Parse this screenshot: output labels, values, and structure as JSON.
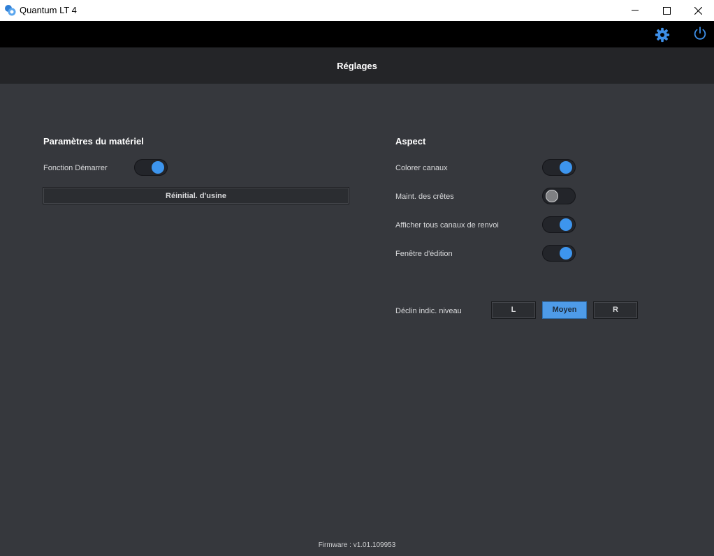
{
  "window": {
    "title": "Quantum LT 4",
    "accent": "#3d95ee"
  },
  "toolbar": {
    "settings_icon": "gear-icon",
    "power_icon": "power-icon"
  },
  "header": {
    "title": "Réglages"
  },
  "hardware": {
    "title": "Paramètres du matériel",
    "start_label": "Fonction Démarrer",
    "start_on": true,
    "factory_reset_label": "Réinitial. d'usine"
  },
  "aspect": {
    "title": "Aspect",
    "items": [
      {
        "label": "Colorer canaux",
        "on": true
      },
      {
        "label": "Maint. des crêtes",
        "on": false
      },
      {
        "label": "Afficher tous canaux de renvoi",
        "on": true
      },
      {
        "label": "Fenêtre d'édition",
        "on": true
      }
    ],
    "level_decay": {
      "label": "Déclin indic. niveau",
      "options": [
        "L",
        "Moyen",
        "R"
      ],
      "selected": "Moyen"
    }
  },
  "footer": {
    "firmware": "Firmware : v1.01.109953"
  }
}
